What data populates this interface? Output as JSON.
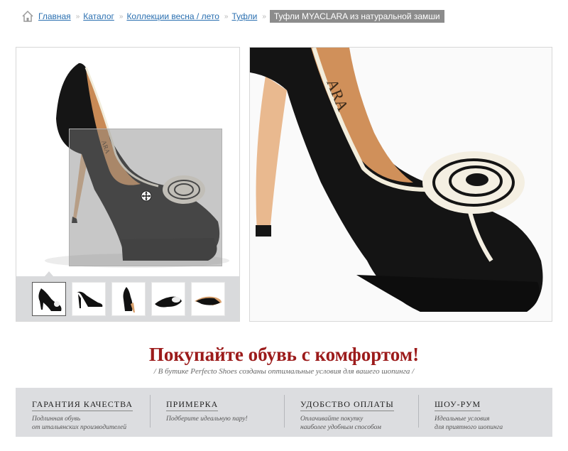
{
  "breadcrumb": {
    "items": [
      "Главная",
      "Каталог",
      "Коллекции весна / лето",
      "Туфли"
    ],
    "current": "Туфли MYACLARA из натуральной замши",
    "separator": "»"
  },
  "gallery": {
    "brand_print": "ARA",
    "thumbnails": [
      "thumb-1",
      "thumb-2",
      "thumb-3",
      "thumb-4",
      "thumb-5"
    ],
    "active_thumbnail": 0
  },
  "zoom": {
    "brand_print": "ARA"
  },
  "promo": {
    "title": "Покупайте обувь с комфортом!",
    "subtitle": "/  В бутике Perfecto Shoes созданы оптимальные условия для вашего шопинга  /"
  },
  "features": [
    {
      "title": "ГАРАНТИЯ КАЧЕСТВА",
      "text": "Подлинная обувь\nот итальянских производителей"
    },
    {
      "title": "ПРИМЕРКА",
      "text": "Подберите идеальную пару!"
    },
    {
      "title": "УДОБСТВО ОПЛАТЫ",
      "text": "Оплачивайте покупку\nнаиболее удобным способом"
    },
    {
      "title": "ШОУ-РУМ",
      "text": "Идеальные условия\nдля приятного шопинга"
    }
  ],
  "colors": {
    "link": "#2a6fb0",
    "title_red": "#9c1b1b",
    "strip_gray": "#dcdde0"
  }
}
